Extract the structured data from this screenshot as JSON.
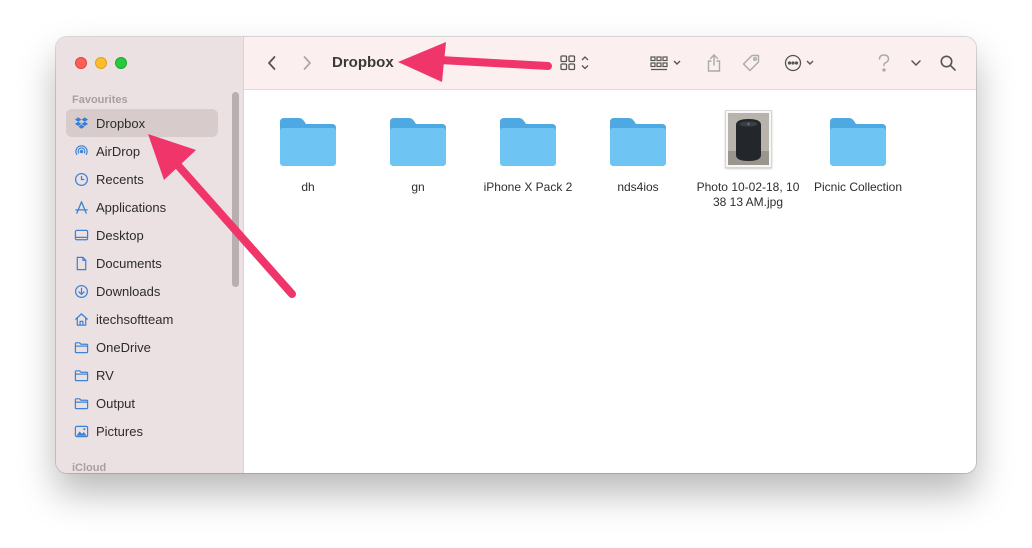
{
  "window": {
    "title": "Dropbox"
  },
  "sidebar": {
    "favourites_label": "Favourites",
    "icloud_label": "iCloud",
    "items": [
      {
        "label": "Dropbox",
        "icon": "dropbox-icon",
        "selected": true
      },
      {
        "label": "AirDrop",
        "icon": "airdrop-icon"
      },
      {
        "label": "Recents",
        "icon": "clock-icon"
      },
      {
        "label": "Applications",
        "icon": "applications-icon"
      },
      {
        "label": "Desktop",
        "icon": "desktop-icon"
      },
      {
        "label": "Documents",
        "icon": "document-icon"
      },
      {
        "label": "Downloads",
        "icon": "download-icon"
      },
      {
        "label": "itechsoftteam",
        "icon": "home-icon"
      },
      {
        "label": "OneDrive",
        "icon": "folder-icon"
      },
      {
        "label": "RV",
        "icon": "folder-icon"
      },
      {
        "label": "Output",
        "icon": "folder-icon"
      },
      {
        "label": "Pictures",
        "icon": "pictures-icon"
      }
    ]
  },
  "toolbar": {
    "icons": [
      "back-icon",
      "forward-icon",
      "icon-view-icon",
      "group-icon",
      "share-icon",
      "tag-icon",
      "more-icon",
      "help-icon",
      "chevron-down-icon",
      "search-icon"
    ]
  },
  "content": {
    "items": [
      {
        "name": "dh",
        "kind": "folder"
      },
      {
        "name": "gn",
        "kind": "folder"
      },
      {
        "name": "iPhone X Pack 2",
        "kind": "folder"
      },
      {
        "name": "nds4ios",
        "kind": "folder"
      },
      {
        "name": "Photo 10-02-18, 10 38 13 AM.jpg",
        "kind": "image"
      },
      {
        "name": "Picnic Collection",
        "kind": "folder"
      }
    ]
  },
  "colors": {
    "folder": "#5ab8ec",
    "accent_arrow": "#f0356a",
    "sidebar_bg": "#ece1e2"
  }
}
